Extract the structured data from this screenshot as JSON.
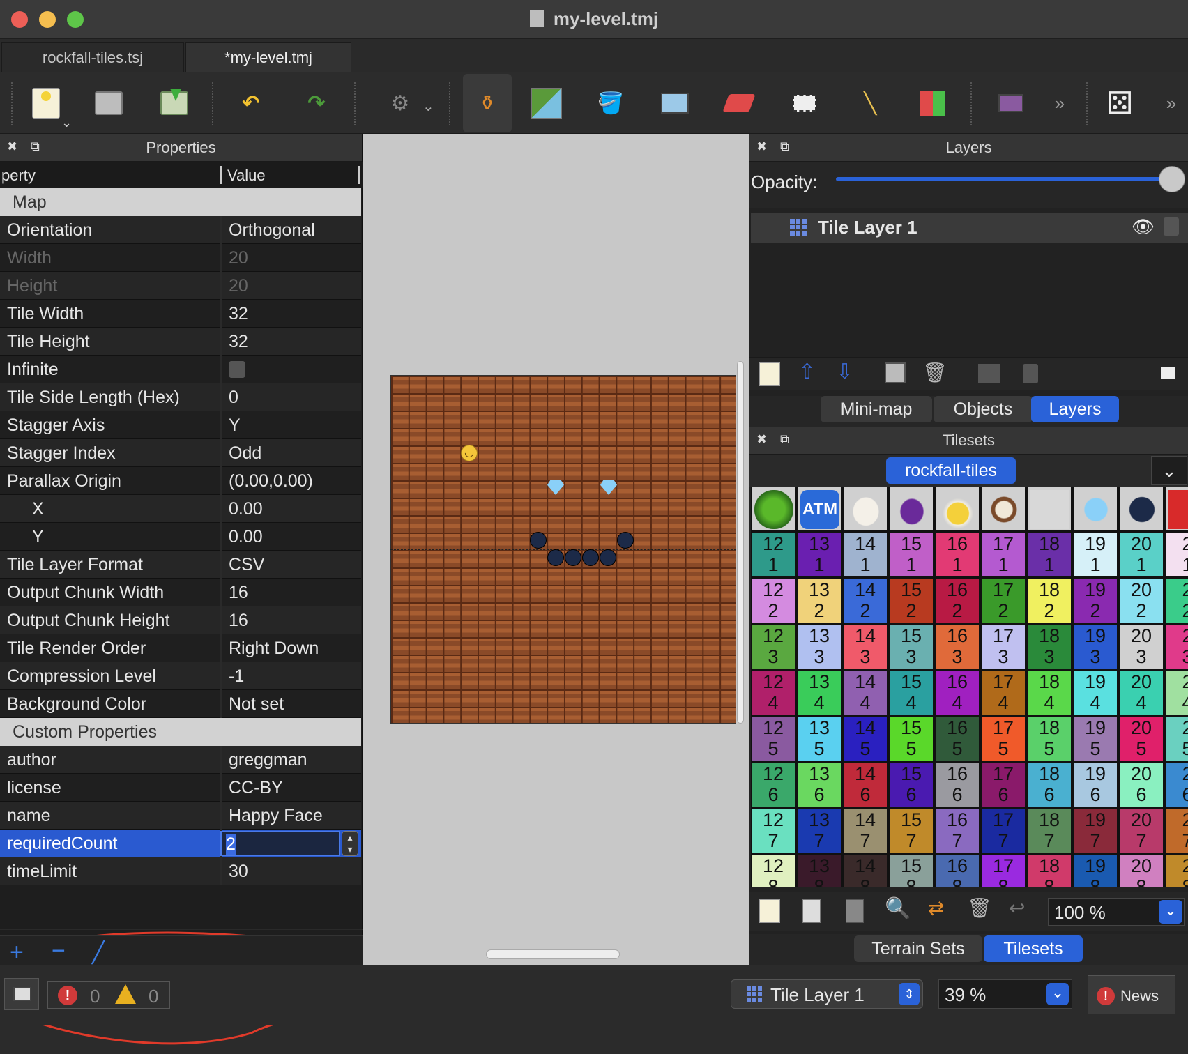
{
  "window": {
    "title": "my-level.tmj"
  },
  "doc_tabs": [
    {
      "label": "rockfall-tiles.tsj",
      "active": false
    },
    {
      "label": "*my-level.tmj",
      "active": true
    }
  ],
  "toolbar": {
    "icons": [
      "new-map-icon",
      "open-file-icon",
      "save-icon",
      "undo-icon",
      "redo-icon",
      "command-icon",
      "stamp-brush-icon",
      "terrain-brush-icon",
      "bucket-fill-icon",
      "shape-fill-icon",
      "eraser-icon",
      "rectangle-select-icon",
      "magic-wand-icon",
      "select-same-tile-icon",
      "object-tools-icon",
      "more-chevron-icon",
      "random-mode-icon",
      "more-chevron-icon"
    ]
  },
  "properties_panel": {
    "title": "Properties",
    "col_property": "perty",
    "col_value": "Value",
    "groups": [
      {
        "label": "Map"
      },
      {
        "label": "Custom Properties"
      }
    ],
    "map_rows": [
      {
        "name": "Orientation",
        "value": "Orthogonal"
      },
      {
        "name": "Width",
        "value": "20",
        "disabled": true
      },
      {
        "name": "Height",
        "value": "20",
        "disabled": true
      },
      {
        "name": "Tile Width",
        "value": "32"
      },
      {
        "name": "Tile Height",
        "value": "32"
      },
      {
        "name": "Infinite",
        "value": ""
      },
      {
        "name": "Tile Side Length (Hex)",
        "value": "0"
      },
      {
        "name": "Stagger Axis",
        "value": "Y"
      },
      {
        "name": "Stagger Index",
        "value": "Odd"
      },
      {
        "name": "Parallax Origin",
        "value": "(0.00,0.00)"
      },
      {
        "name": "X",
        "value": "0.00",
        "indent": true
      },
      {
        "name": "Y",
        "value": "0.00",
        "indent": true
      },
      {
        "name": "Tile Layer Format",
        "value": "CSV"
      },
      {
        "name": "Output Chunk Width",
        "value": "16"
      },
      {
        "name": "Output Chunk Height",
        "value": "16"
      },
      {
        "name": "Tile Render Order",
        "value": "Right Down"
      },
      {
        "name": "Compression Level",
        "value": "-1"
      },
      {
        "name": "Background Color",
        "value": "Not set"
      }
    ],
    "custom_rows": [
      {
        "name": "author",
        "value": "greggman"
      },
      {
        "name": "license",
        "value": "CC-BY"
      },
      {
        "name": "name",
        "value": "Happy Face"
      },
      {
        "name": "requiredCount",
        "value": "2",
        "editing": true
      },
      {
        "name": "timeLimit",
        "value": "30"
      }
    ]
  },
  "layers_panel": {
    "title": "Layers",
    "opacity_label": "Opacity:",
    "opacity": 1.0,
    "layer_name": "Tile Layer 1",
    "tabs": [
      "Mini-map",
      "Objects",
      "Layers"
    ],
    "active_tab": "Layers"
  },
  "tilesets_panel": {
    "title": "Tilesets",
    "selected_tileset": "rockfall-tiles",
    "zoom": "100 %",
    "tabs": [
      "Terrain Sets",
      "Tilesets"
    ],
    "active_tab": "Tilesets",
    "top_row_icons": [
      "virus-icon",
      "atm-icon",
      "egg-icon",
      "eggplant-icon",
      "hatching-chick-icon",
      "coconut-icon",
      "blank-tile-icon",
      "gem-icon",
      "rock-icon",
      "red-tile-icon"
    ],
    "column_labels": [
      "12",
      "13",
      "14",
      "15",
      "16",
      "17",
      "18",
      "19",
      "20",
      "2"
    ],
    "row_labels": [
      "1",
      "2",
      "3",
      "4",
      "5",
      "6",
      "7",
      "8"
    ],
    "colors": [
      [
        "#2e9a8a",
        "#6a1fb0",
        "#9fb3cf",
        "#c05fc8",
        "#e23a74",
        "#b45ad0",
        "#6a2fa8",
        "#d6f0f8",
        "#5ad0c8",
        "#f3e0f0"
      ],
      [
        "#d48be0",
        "#f0d27a",
        "#3a6ad8",
        "#b83a20",
        "#b81a44",
        "#3a9a2a",
        "#f0f060",
        "#8a2ab0",
        "#8ae0f0",
        "#3acc8a"
      ],
      [
        "#5aa840",
        "#b0c0f0",
        "#f05a6a",
        "#6ab0b0",
        "#e06a3a",
        "#c0c0f0",
        "#2a8a3a",
        "#2a5ad0",
        "#d0d0d0",
        "#e03a8a"
      ],
      [
        "#b0206a",
        "#3acc5a",
        "#9060b0",
        "#2aa0a0",
        "#a020c0",
        "#b06a1a",
        "#5ad84a",
        "#5ae0e0",
        "#3ad0b0",
        "#a0e0a0"
      ],
      [
        "#8a5aa0",
        "#5ad0f0",
        "#2a20c0",
        "#5ad82a",
        "#305a3a",
        "#f05a2a",
        "#5ad06a",
        "#9a7ab0",
        "#e0206a",
        "#6ad0c0"
      ],
      [
        "#3aa86a",
        "#6ad860",
        "#c02a3a",
        "#4a1ab0",
        "#9a9aa0",
        "#8a1a6a",
        "#4ab0d0",
        "#a8c8e0",
        "#8af0c0",
        "#3a8ad0"
      ],
      [
        "#6ae0c0",
        "#1a3ab0",
        "#9a9070",
        "#c08a2a",
        "#8a6ac0",
        "#1a2aa0",
        "#5a8a5a",
        "#8a2a3a",
        "#b83a6a",
        "#c06a2a"
      ],
      [
        "#e0f0c0",
        "#3a1a2a",
        "#3a2a2a",
        "#8aa09a",
        "#4a6ab0",
        "#9a2ae0",
        "#d03a6a",
        "#1a5ab0",
        "#d080c0",
        "#c08a2a"
      ]
    ]
  },
  "status_bar": {
    "errors": "0",
    "warnings": "0",
    "layer_select": "Tile Layer 1",
    "zoom": "39 %",
    "news": "News"
  },
  "accent": "#2a62d8"
}
